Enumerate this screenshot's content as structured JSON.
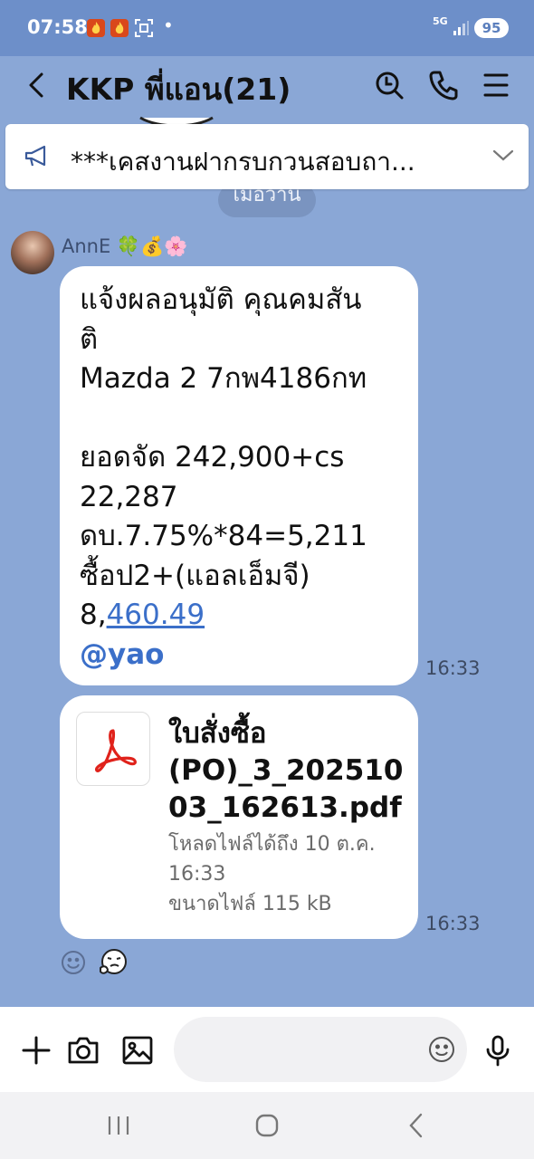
{
  "status_bar": {
    "time": "07:58",
    "network": "5G",
    "battery": "95"
  },
  "header": {
    "title": "KKP พี่แอน(21)"
  },
  "announcement": {
    "text": "***เคสงานฝากรบกวนสอบถา..."
  },
  "date_pill": "เมื่อวาน",
  "messages": [
    {
      "sender": "AnnE 🍀💰🌸",
      "lines": [
        "แจ้งผลอนุมัติ คุณคมสัน",
        "ติ",
        "Mazda 2 7กพ4186กท",
        "",
        "ยอดจัด 242,900+cs",
        "22,287",
        "ดบ.7.75%*84=5,211",
        "ซื้อป2+(แอลเอ็มจี)"
      ],
      "amount_prefix": "8,",
      "amount_link": "460.49",
      "mention": "@yao",
      "time": "16:33"
    },
    {
      "file_name_lines": [
        "ใบสั่งซื้อ",
        "(PO)_3_202510",
        "03_162613.pdf"
      ],
      "download_until": "โหลดไฟล์ได้ถึง 10 ต.ค.",
      "download_time": "16:33",
      "file_size": "ขนาดไฟล์ 115 kB",
      "time": "16:33"
    }
  ],
  "colors": {
    "chat_background": "#8aa7d6",
    "link": "#3b6fc9",
    "pdf_red": "#e0221b"
  }
}
